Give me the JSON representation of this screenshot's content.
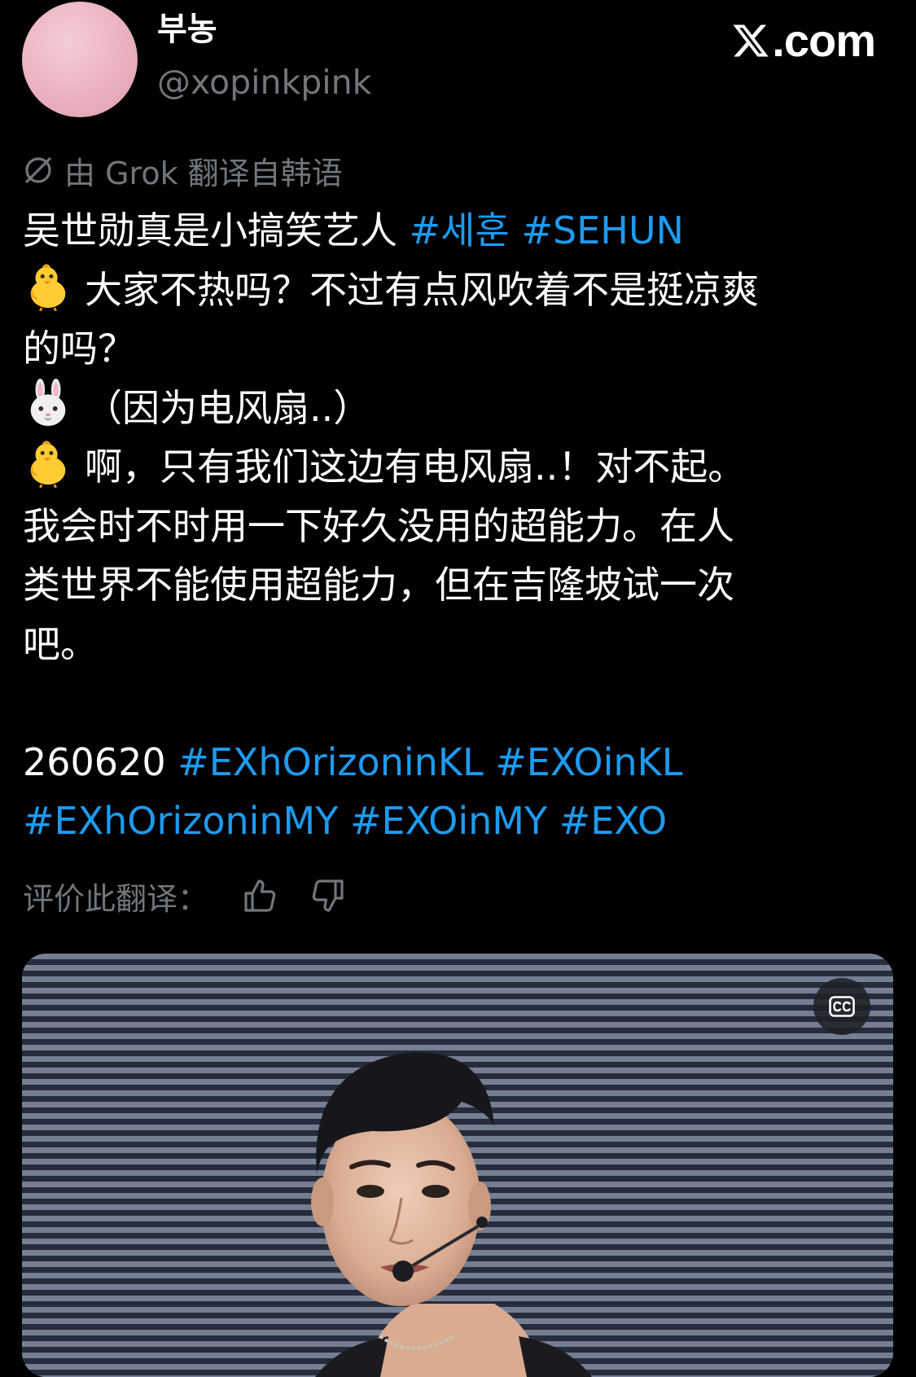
{
  "author": {
    "display_name": "부농",
    "handle": "@xopinkpink",
    "avatar_color": "#eab2be"
  },
  "brand": {
    "text": ".com",
    "icon": "x-logo-icon"
  },
  "translation": {
    "note": "由 Grok 翻译自韩语",
    "icon": "grok-icon",
    "rate_label": "评价此翻译：",
    "thumbs_up_icon": "thumbs-up-icon",
    "thumbs_down_icon": "thumbs-down-icon"
  },
  "tweet": {
    "line1_text": "吴世勋真是小搞笑艺人 ",
    "line1_tags": [
      "#세훈",
      "#SEHUN"
    ],
    "line2_emoji": "chick-emoji",
    "line2_text": "大家不热吗？不过有点风吹着不是挺凉爽",
    "line3_text": "的吗？",
    "line4_emoji": "rabbit-emoji",
    "line4_text": "（因为电风扇..）",
    "line5_emoji": "chick-emoji",
    "line5_text": "啊，只有我们这边有电风扇..！对不起。",
    "line6_text": "我会时不时用一下好久没用的超能力。在人",
    "line7_text": "类世界不能使用超能力，但在吉隆坡试一次",
    "line8_text": "吧。",
    "date": "260620",
    "tags_line1": [
      "#EXhOrizoninKL",
      "#EXOinKL"
    ],
    "tags_line2": [
      "#EXhOrizoninMY",
      "#EXOinMY",
      "#EXO"
    ]
  },
  "video": {
    "cc_icon": "closed-captions-icon"
  },
  "colors": {
    "background": "#000000",
    "text": "#ffffff",
    "secondary": "#71767b",
    "link": "#1d9bf0"
  }
}
